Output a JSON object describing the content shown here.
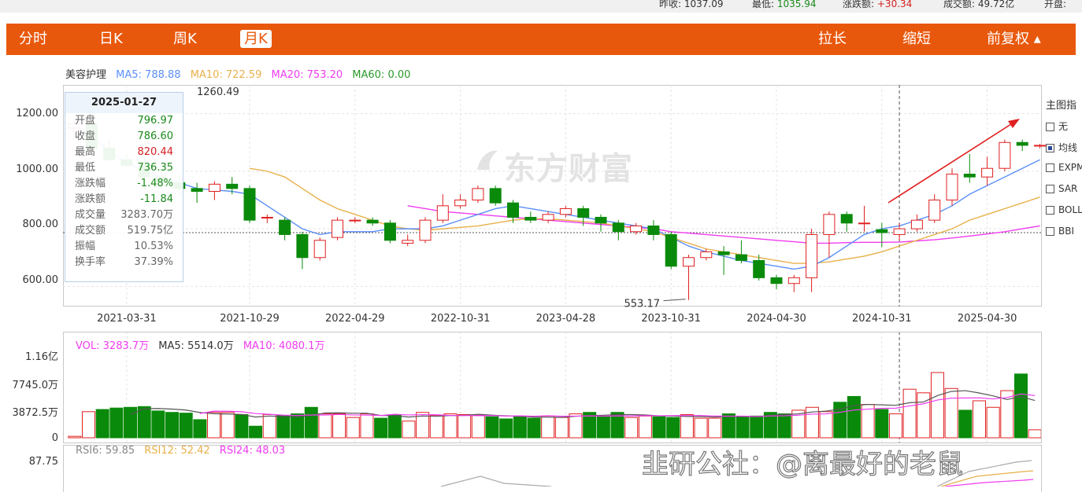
{
  "top_strip": {
    "items": [
      {
        "label": "昨收:",
        "value": "1037.09"
      },
      {
        "label": "最低:",
        "value": "1035.94"
      },
      {
        "label": "涨跌额:",
        "value": "+30.34"
      },
      {
        "label": "成交额:",
        "value": "49.72亿"
      },
      {
        "label": "开盘:",
        "value": ""
      }
    ]
  },
  "toolbar": {
    "tabs": [
      "分时",
      "日K",
      "周K",
      "月K"
    ],
    "active_tab": "月K",
    "right_buttons": [
      "拉长",
      "缩短",
      "前复权 ▴"
    ]
  },
  "legend": {
    "name": "美容护理",
    "ma": [
      {
        "label": "MA5: 788.88",
        "color": "#5b8ff9"
      },
      {
        "label": "MA10: 722.59",
        "color": "#e8b04a"
      },
      {
        "label": "MA20: 753.20",
        "color": "#f03cf0"
      },
      {
        "label": "MA60: 0.00",
        "color": "#2a9a2a"
      }
    ]
  },
  "tooltip": {
    "date": "2025-01-27",
    "rows": [
      {
        "k": "开盘",
        "v": "796.97",
        "color": "#1a8a1a"
      },
      {
        "k": "收盘",
        "v": "786.60",
        "color": "#1a8a1a"
      },
      {
        "k": "最高",
        "v": "820.44",
        "color": "#d42020"
      },
      {
        "k": "最低",
        "v": "736.35",
        "color": "#1a8a1a"
      },
      {
        "k": "涨跌幅",
        "v": "-1.48%",
        "color": "#1a8a1a"
      },
      {
        "k": "涨跌额",
        "v": "-11.84",
        "color": "#1a8a1a"
      },
      {
        "k": "成交量",
        "v": "3283.70万",
        "color": "#666666"
      },
      {
        "k": "成交额",
        "v": "519.75亿",
        "color": "#666666"
      },
      {
        "k": "振幅",
        "v": "10.53%",
        "color": "#666666"
      },
      {
        "k": "换手率",
        "v": "37.39%",
        "color": "#666666"
      }
    ]
  },
  "side_panel": {
    "title": "主图指",
    "options": [
      {
        "label": "无",
        "checked": false
      },
      {
        "label": "均线",
        "checked": true
      },
      {
        "label": "EXPM",
        "checked": false
      },
      {
        "label": "SAR",
        "checked": false
      },
      {
        "label": "BOLL",
        "checked": false
      },
      {
        "label": "BBI",
        "checked": false
      }
    ]
  },
  "watermark": "东方财富",
  "volume_legend": [
    {
      "label": "VOL: 3283.7万",
      "color": "#f03cf0"
    },
    {
      "label": "MA5: 5514.0万",
      "color": "#333333"
    },
    {
      "label": "MA10: 4080.1万",
      "color": "#f03cf0"
    }
  ],
  "rsi_legend": [
    {
      "label": "RSI6: 59.85",
      "color": "#888888"
    },
    {
      "label": "RSI12: 52.42",
      "color": "#e8b04a"
    },
    {
      "label": "RSI24: 48.03",
      "color": "#f03cf0"
    }
  ],
  "footer_watermark": "韭研公社：@离最好的老鼠",
  "chart_data": {
    "type": "candlestick",
    "price_axis": {
      "ticks": [
        "1200.00",
        "1000.00",
        "800.00",
        "600.00"
      ],
      "tick_values": [
        1200,
        1000,
        800,
        600
      ],
      "ylim": [
        530,
        1300
      ]
    },
    "x_ticks": [
      "2021-03-31",
      "2021-10-29",
      "2022-04-29",
      "2022-10-31",
      "2023-04-28",
      "2023-10-31",
      "2024-04-30",
      "2024-10-31",
      "2025-04-30"
    ],
    "x_tick_index": [
      3,
      10,
      16,
      22,
      28,
      34,
      40,
      46,
      52
    ],
    "max_label": "1260.49",
    "min_label": "553.17",
    "ref_line": 786.6,
    "crosshair_index": 47,
    "candles": [
      [
        1150,
        1165,
        1120,
        1175
      ],
      [
        1165,
        1080,
        1070,
        1180
      ],
      [
        1080,
        1040,
        1035,
        1110
      ],
      [
        1040,
        1020,
        1015,
        1060
      ],
      [
        1020,
        980,
        960,
        1050
      ],
      [
        980,
        960,
        940,
        1000
      ],
      [
        960,
        940,
        920,
        990
      ],
      [
        940,
        930,
        890,
        960
      ],
      [
        930,
        955,
        900,
        965
      ],
      [
        955,
        940,
        920,
        980
      ],
      [
        940,
        830,
        820,
        950
      ],
      [
        840,
        840,
        820,
        850
      ],
      [
        830,
        780,
        760,
        840
      ],
      [
        780,
        700,
        660,
        790
      ],
      [
        700,
        760,
        690,
        770
      ],
      [
        770,
        830,
        760,
        840
      ],
      [
        830,
        830,
        820,
        840
      ],
      [
        830,
        820,
        810,
        840
      ],
      [
        820,
        760,
        750,
        830
      ],
      [
        750,
        760,
        740,
        780
      ],
      [
        760,
        830,
        750,
        840
      ],
      [
        830,
        880,
        820,
        920
      ],
      [
        880,
        900,
        870,
        920
      ],
      [
        900,
        940,
        890,
        950
      ],
      [
        940,
        890,
        880,
        950
      ],
      [
        890,
        840,
        820,
        900
      ],
      [
        840,
        830,
        820,
        860
      ],
      [
        830,
        850,
        820,
        860
      ],
      [
        850,
        870,
        840,
        880
      ],
      [
        870,
        840,
        810,
        880
      ],
      [
        840,
        820,
        790,
        850
      ],
      [
        820,
        790,
        760,
        830
      ],
      [
        790,
        810,
        780,
        820
      ],
      [
        810,
        780,
        760,
        830
      ],
      [
        780,
        670,
        660,
        790
      ],
      [
        670,
        700,
        553,
        710
      ],
      [
        700,
        720,
        690,
        730
      ],
      [
        720,
        710,
        640,
        740
      ],
      [
        710,
        690,
        680,
        760
      ],
      [
        690,
        630,
        620,
        710
      ],
      [
        630,
        610,
        590,
        640
      ],
      [
        610,
        630,
        580,
        640
      ],
      [
        630,
        780,
        580,
        800
      ],
      [
        780,
        850,
        700,
        860
      ],
      [
        850,
        820,
        790,
        860
      ],
      [
        820,
        820,
        790,
        880
      ],
      [
        796.97,
        786.6,
        736.35,
        820.44
      ],
      [
        780,
        800,
        760,
        820
      ],
      [
        800,
        830,
        790,
        850
      ],
      [
        830,
        900,
        820,
        920
      ],
      [
        900,
        990,
        880,
        1010
      ],
      [
        990,
        980,
        960,
        1060
      ],
      [
        980,
        1010,
        950,
        1050
      ],
      [
        1010,
        1100,
        1000,
        1110
      ],
      [
        1100,
        1090,
        1070,
        1110
      ],
      [
        1090,
        1090,
        1080,
        1095
      ]
    ],
    "ma5": [
      1160,
      1120,
      1070,
      1030,
      1000,
      980,
      960,
      940,
      935,
      930,
      920,
      880,
      840,
      800,
      780,
      790,
      790,
      790,
      800,
      800,
      800,
      810,
      830,
      850,
      870,
      880,
      870,
      860,
      850,
      840,
      830,
      820,
      810,
      800,
      770,
      740,
      720,
      705,
      690,
      680,
      670,
      660,
      670,
      700,
      740,
      780,
      800,
      810,
      830,
      850,
      880,
      920,
      950,
      980,
      1010,
      1040
    ],
    "ma10": [
      null,
      null,
      null,
      null,
      null,
      null,
      null,
      null,
      null,
      null,
      1010,
      1000,
      980,
      940,
      900,
      870,
      850,
      830,
      810,
      800,
      795,
      800,
      805,
      810,
      820,
      830,
      835,
      835,
      830,
      825,
      820,
      810,
      800,
      790,
      770,
      750,
      730,
      720,
      710,
      700,
      690,
      680,
      680,
      685,
      695,
      705,
      720,
      740,
      760,
      780,
      800,
      830,
      850,
      870,
      890,
      910
    ],
    "ma20": [
      null,
      null,
      null,
      null,
      null,
      null,
      null,
      null,
      null,
      null,
      null,
      null,
      null,
      null,
      null,
      null,
      null,
      null,
      null,
      880,
      870,
      860,
      855,
      850,
      845,
      840,
      835,
      830,
      825,
      820,
      815,
      810,
      805,
      800,
      790,
      785,
      780,
      775,
      770,
      765,
      760,
      755,
      750,
      750,
      752,
      753,
      753,
      754,
      758,
      762,
      768,
      775,
      782,
      790,
      800,
      810
    ],
    "volume_axis": {
      "ticks": [
        "1.16亿",
        "7745.0万",
        "3872.5万",
        "0"
      ],
      "tick_values": [
        11600,
        7745,
        3872.5,
        0
      ]
    },
    "volumes": [
      200,
      3600,
      3900,
      4100,
      4200,
      4300,
      3700,
      3500,
      3400,
      2500,
      3500,
      3500,
      3200,
      1600,
      3200,
      3100,
      3300,
      4200,
      3300,
      3300,
      2800,
      3300,
      2700,
      3200,
      2300,
      3500,
      3100,
      3300,
      3200,
      3100,
      2900,
      2600,
      3000,
      2700,
      3000,
      2800,
      3300,
      3500,
      2900,
      3500,
      2800,
      3000,
      2900,
      2800,
      3200,
      2700,
      2700,
      3300,
      2900,
      3000,
      3500,
      3300,
      3800,
      4200,
      3600,
      4900,
      5700,
      4600,
      3900,
      3300,
      6700,
      6200,
      9000,
      6800,
      3800,
      5100,
      4200,
      6500,
      8800,
      1100
    ]
  }
}
